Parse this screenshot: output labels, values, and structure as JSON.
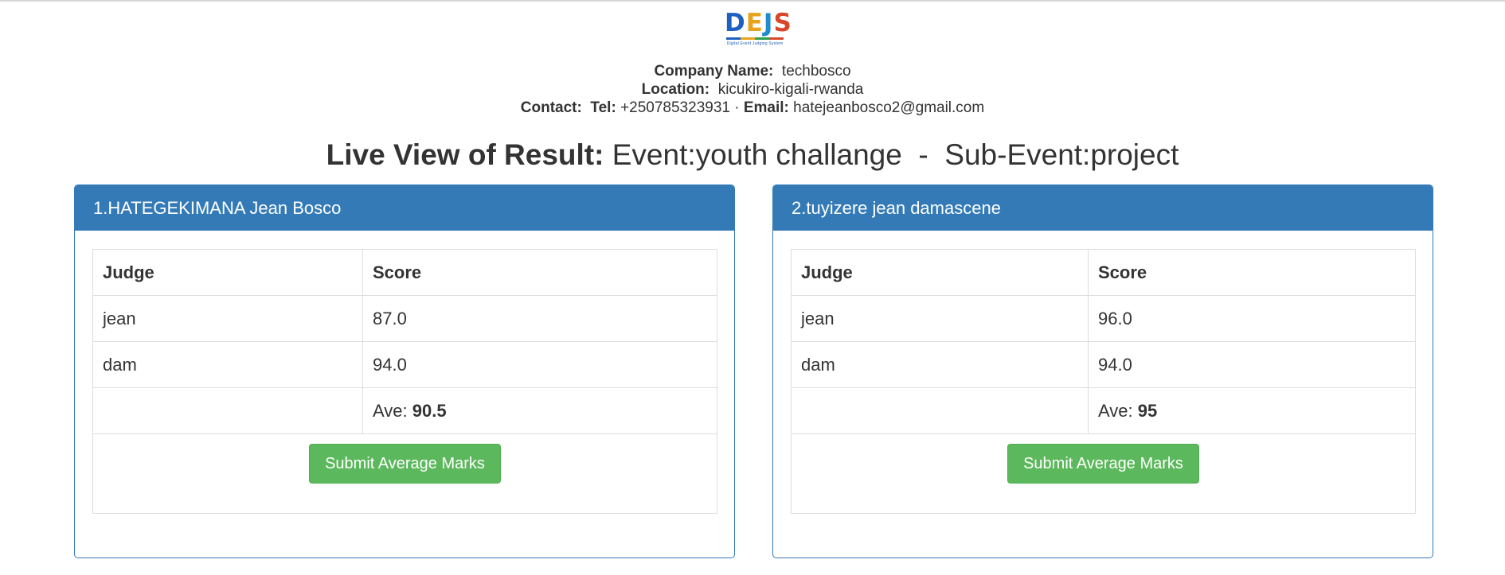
{
  "logo": {
    "letters": [
      "D",
      "E",
      "J",
      "S"
    ],
    "tagline": "Digital Event Judging System"
  },
  "company": {
    "name_label": "Company Name:",
    "name": "techbosco",
    "location_label": "Location:",
    "location": "kicukiro-kigali-rwanda",
    "contact_label": "Contact:",
    "tel_label": "Tel:",
    "tel": "+250785323931",
    "separator": "·",
    "email_label": "Email:",
    "email": "hatejeanbosco2@gmail.com"
  },
  "headline": {
    "bold": "Live View of Result:",
    "rest": "Event:youth challange  -  Sub-Event:project"
  },
  "table_headers": {
    "judge": "Judge",
    "score": "Score"
  },
  "ave_label": "Ave:",
  "submit_label": "Submit Average Marks",
  "contestants": [
    {
      "title": "1.HATEGEKIMANA Jean Bosco",
      "rows": [
        {
          "judge": "jean",
          "score": "87.0"
        },
        {
          "judge": "dam",
          "score": "94.0"
        }
      ],
      "average": "90.5"
    },
    {
      "title": "2.tuyizere jean damascene",
      "rows": [
        {
          "judge": "jean",
          "score": "96.0"
        },
        {
          "judge": "dam",
          "score": "94.0"
        }
      ],
      "average": "95"
    }
  ],
  "colors": {
    "panel_primary": "#337ab7",
    "button_success": "#5cb85c",
    "text": "#333333"
  }
}
